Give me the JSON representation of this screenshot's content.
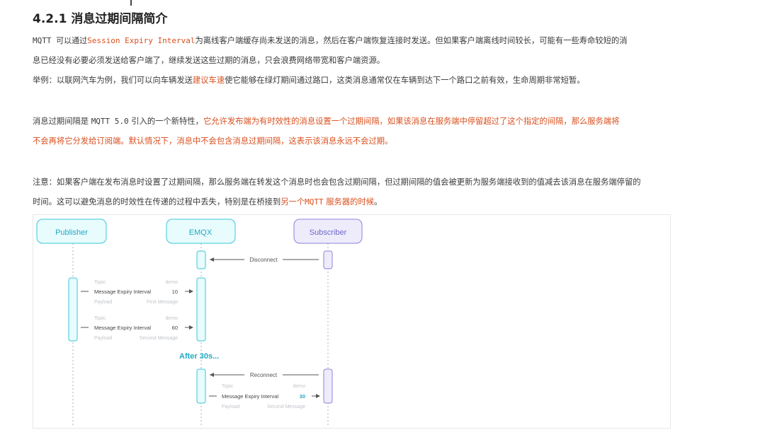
{
  "section": {
    "title": "4.2.1 消息过期间隔简介"
  },
  "p1": {
    "l1_a": "MQTT 可以通过",
    "l1_code": "Session Expiry Interval",
    "l1_b": "为离线客户端缓存尚未发送的消息，然后在客户端恢复连接时发送。但如果客户端离线时间较长，可能有一些寿命较短的消",
    "l2": "息已经没有必要必须发送给客户端了，继续发送这些过期的消息，只会浪费网络带宽和客户端资源。"
  },
  "p2": {
    "a": "举例：以联网汽车为例，我们可以向车辆发送",
    "hl": "建议车速",
    "b": "使它能够在绿灯期间通过路口，这类消息通常仅在车辆到达下一个路口之前有效，生命周期非常短暂。"
  },
  "p3": {
    "l1_a": "消息过期间隔是",
    "l1_code": "MQTT 5.0",
    "l1_b": "引入的一个新特性，",
    "l1_hl": "它允许发布端为有时效性的消息设置一个过期间隔，如果该消息在服务端中停留超过了这个指定的间隔，那么服务端将",
    "l2_hl": "不会再将它分发给订阅端。默认情况下，消息中不会包含消息过期间隔，这表示该消息永远不会过期。"
  },
  "p4": {
    "l1": "注意：如果客户端在发布消息时设置了过期间隔，那么服务端在转发这个消息时也会包含过期间隔，但过期间隔的值会被更新为服务端接收到的值减去该消息在服务端停留的",
    "l2_a": "时间。这可以避免消息的时效性在传递的过程中丢失，特别是在桥接到",
    "l2_hl_a": "另一个",
    "l2_code": "MQTT",
    "l2_hl_b": "服务器的时候",
    "l2_end": "。"
  },
  "diagram": {
    "actors": [
      "Publisher",
      "EMQX",
      "Subscriber"
    ],
    "disconnect": "Disconnect",
    "reconnect": "Reconnect",
    "after": "After 30s...",
    "msg1": {
      "topic_label": "Topic",
      "topic_value": "demo",
      "expiry_label": "Message Expiry Interval",
      "expiry_value": "10",
      "payload_label": "Payload",
      "payload_value": "First Message"
    },
    "msg2": {
      "topic_label": "Topic",
      "topic_value": "demo",
      "expiry_label": "Message Expiry Interval",
      "expiry_value": "60",
      "payload_label": "Payload",
      "payload_value": "Second Message"
    },
    "msg3": {
      "topic_label": "Topic",
      "topic_value": "demo",
      "expiry_label": "Message Expiry Interval",
      "expiry_value": "30",
      "payload_label": "Payload",
      "payload_value": "Second Message"
    },
    "colors": {
      "cyan": "#38c8d8",
      "cyan_fill": "#e8fbfd",
      "purple": "#8a83d8",
      "purple_fill": "#eeecfb",
      "accent_text": "#22a9c4"
    }
  }
}
